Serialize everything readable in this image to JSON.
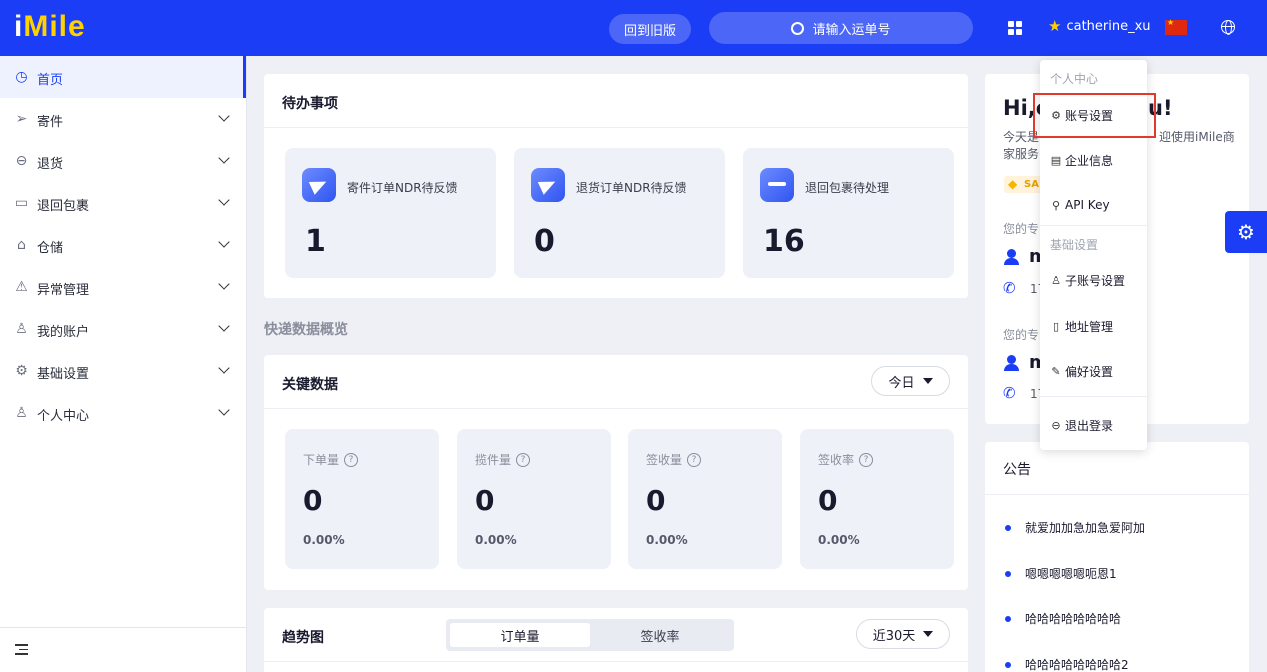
{
  "header": {
    "logo_i": "i",
    "logo_rest": "Mile",
    "old_version_label": "回到旧版",
    "search_placeholder": "请输入运单号",
    "username": "catherine_xu"
  },
  "sidebar": {
    "items": [
      {
        "label": "首页",
        "icon": "dashboard-icon"
      },
      {
        "label": "寄件",
        "icon": "send-icon"
      },
      {
        "label": "退货",
        "icon": "return-icon"
      },
      {
        "label": "退回包裹",
        "icon": "package-icon"
      },
      {
        "label": "仓储",
        "icon": "warehouse-icon"
      },
      {
        "label": "异常管理",
        "icon": "alarm-icon"
      },
      {
        "label": "我的账户",
        "icon": "user-icon"
      },
      {
        "label": "基础设置",
        "icon": "gear-icon"
      },
      {
        "label": "个人中心",
        "icon": "person-icon"
      }
    ]
  },
  "todo": {
    "title": "待办事项",
    "items": [
      {
        "label": "寄件订单NDR待反馈",
        "value": "1"
      },
      {
        "label": "退货订单NDR待反馈",
        "value": "0"
      },
      {
        "label": "退回包裹待处理",
        "value": "16"
      }
    ]
  },
  "overview_title": "快递数据概览",
  "key_data": {
    "title": "关键数据",
    "period": "今日",
    "items": [
      {
        "label": "下单量",
        "value": "0",
        "pct": "0.00%"
      },
      {
        "label": "揽件量",
        "value": "0",
        "pct": "0.00%"
      },
      {
        "label": "签收量",
        "value": "0",
        "pct": "0.00%"
      },
      {
        "label": "签收率",
        "value": "0",
        "pct": "0.00%"
      }
    ]
  },
  "trend": {
    "title": "趋势图",
    "tabs": [
      "订单量",
      "签收率"
    ],
    "period": "近30天"
  },
  "welcome": {
    "greeting_start": "Hi,c",
    "greeting_end": "u!",
    "line1_start": "今天是",
    "line1_end": "迎使用iMile商",
    "line2": "家服务",
    "badge": "SA",
    "exclusive_label": "您的专",
    "contact1_name": "m",
    "contact1_phone": "17",
    "contact2_name": "m",
    "contact2_phone": "17"
  },
  "notice": {
    "title": "公告",
    "items": [
      "就爱加加急加急爱阿加",
      "嗯嗯嗯嗯嗯呃恩1",
      "哈哈哈哈哈哈哈哈",
      "哈哈哈哈哈哈哈哈2"
    ]
  },
  "user_menu": {
    "section1": "个人中心",
    "account_settings": "账号设置",
    "company_info": "企业信息",
    "api_key": "API Key",
    "section2": "基础设置",
    "sub_accounts": "子账号设置",
    "address": "地址管理",
    "preferences": "偏好设置",
    "logout": "退出登录"
  },
  "colors": {
    "brand_blue": "#1a3df5",
    "logo_yellow": "#ffd100",
    "highlight_red": "#e2382e"
  }
}
